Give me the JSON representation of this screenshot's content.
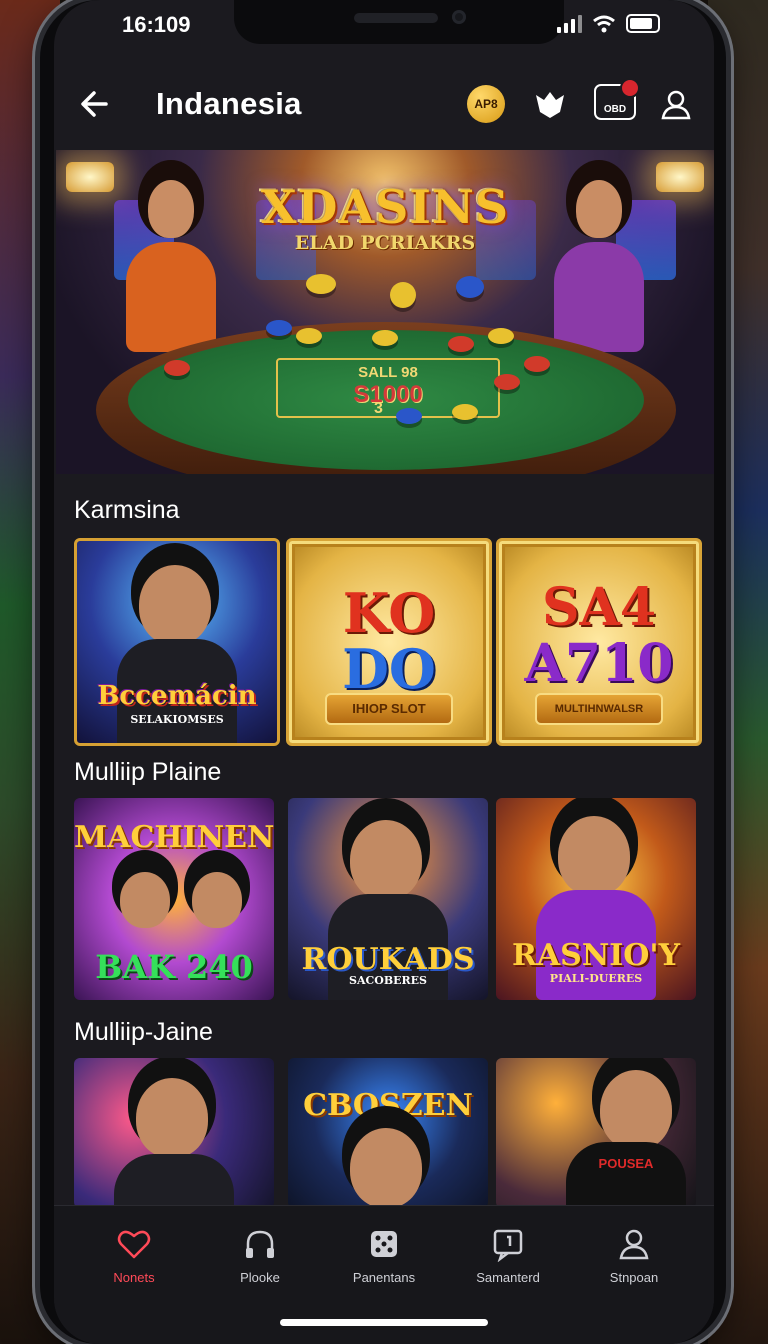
{
  "status": {
    "time": "16:109"
  },
  "header": {
    "title": "Indanesia",
    "coin_label": "AP8",
    "bag_label": "OBD"
  },
  "hero": {
    "title": "XDASINS",
    "subtitle": "ELAD PCRIAKRS",
    "felt_top": "SALL 98",
    "felt_amount": "S1000",
    "felt_number": "3"
  },
  "sections": [
    {
      "title": "Karmsina",
      "cards": [
        {
          "title": "Bccemácin",
          "subtitle": "SELAKIOMSES"
        },
        {
          "title_top": "KO",
          "title_bottom": "DO",
          "plate": "IHIOP SLOT"
        },
        {
          "title_top": "SA4",
          "title_bottom": "A710",
          "plate": "MULTIHNWALSR"
        }
      ]
    },
    {
      "title": "Mulliip Plaine",
      "cards": [
        {
          "title": "MACHINEN",
          "subtitle": "BAK 240"
        },
        {
          "title": "ROUKADS",
          "subtitle": "SACOBERES"
        },
        {
          "title": "RASNIO'Y",
          "subtitle": "PIALI-DUERES"
        }
      ]
    },
    {
      "title": "Mulliip-Jaine",
      "cards": [
        {
          "title": ""
        },
        {
          "title": "CBOSZEN"
        },
        {
          "title": "",
          "shirt": "POUSEA"
        }
      ]
    }
  ],
  "tabs": [
    {
      "label": "Nonets",
      "icon": "heart-icon",
      "active": true
    },
    {
      "label": "Plooke",
      "icon": "headphones-icon",
      "active": false
    },
    {
      "label": "Panentans",
      "icon": "dice-icon",
      "active": false
    },
    {
      "label": "Samanterd",
      "icon": "chat-icon",
      "active": false
    },
    {
      "label": "Stnpoan",
      "icon": "user-icon",
      "active": false
    }
  ],
  "colors": {
    "accent": "#ff4a58",
    "gold": "#f7c02d",
    "background": "#1b1a1f"
  }
}
